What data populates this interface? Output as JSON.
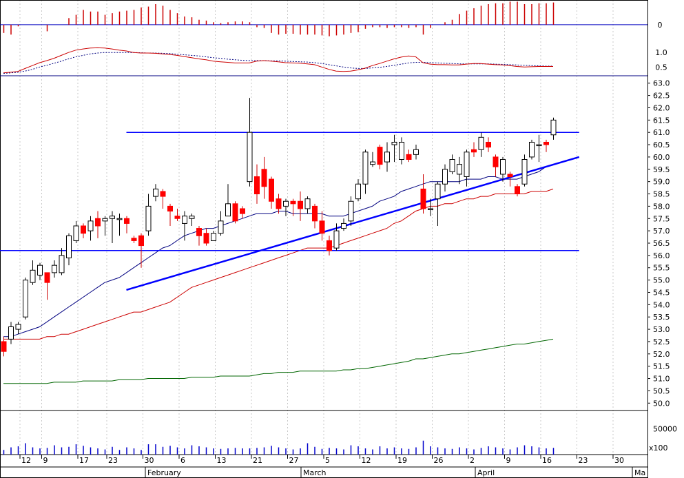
{
  "chart_data": {
    "type": "candlestick",
    "title": "",
    "xlabel": "",
    "ylabel": "",
    "x_axis": {
      "day_ticks": [
        "12",
        "9",
        "17",
        "23",
        "30",
        "6",
        "13",
        "21",
        "27",
        "5",
        "12",
        "19",
        "26",
        "2",
        "9",
        "16",
        "23",
        "30"
      ],
      "month_labels": [
        "February",
        "March",
        "April",
        "Ma"
      ]
    },
    "price_axis": {
      "ylim": [
        49.7,
        63.3
      ],
      "tick_labels": [
        "63.0",
        "62.5",
        "62.0",
        "61.5",
        "61.0",
        "60.5",
        "60.0",
        "59.5",
        "59.0",
        "58.5",
        "58.0",
        "57.5",
        "57.0",
        "56.5",
        "56.0",
        "55.5",
        "55.0",
        "54.5",
        "54.0",
        "53.5",
        "53.0",
        "52.5",
        "52.0",
        "51.5",
        "51.0",
        "50.5",
        "50.0"
      ]
    },
    "candles": [
      [
        52.5,
        52.1,
        52.7,
        51.9
      ],
      [
        52.6,
        53.1,
        53.3,
        52.4
      ],
      [
        53.0,
        53.2,
        53.3,
        52.8
      ],
      [
        53.5,
        55.0,
        55.1,
        53.4
      ],
      [
        54.9,
        55.4,
        55.8,
        54.8
      ],
      [
        55.2,
        55.6,
        55.7,
        55.0
      ],
      [
        55.3,
        54.9,
        55.3,
        54.2
      ],
      [
        55.3,
        55.6,
        55.8,
        55.1
      ],
      [
        55.3,
        56.0,
        56.3,
        55.2
      ],
      [
        55.9,
        56.8,
        56.9,
        55.6
      ],
      [
        56.6,
        57.2,
        57.4,
        56.5
      ],
      [
        57.2,
        56.9,
        57.3,
        56.7
      ],
      [
        57.0,
        57.4,
        57.6,
        56.6
      ],
      [
        57.5,
        57.2,
        57.8,
        56.7
      ],
      [
        57.4,
        57.5,
        57.6,
        56.8
      ],
      [
        57.5,
        57.6,
        57.8,
        56.5
      ],
      [
        57.5,
        57.5,
        57.7,
        56.8
      ],
      [
        57.5,
        57.3,
        57.6,
        56.9
      ],
      [
        56.7,
        56.6,
        56.8,
        56.5
      ],
      [
        56.8,
        56.4,
        56.9,
        55.5
      ],
      [
        57.0,
        58.0,
        58.5,
        56.8
      ],
      [
        58.4,
        58.7,
        58.9,
        58.2
      ],
      [
        58.6,
        58.4,
        58.7,
        57.9
      ],
      [
        58.0,
        57.8,
        58.1,
        57.2
      ],
      [
        57.6,
        57.5,
        57.9,
        57.4
      ],
      [
        57.3,
        57.6,
        57.8,
        56.6
      ],
      [
        57.5,
        57.6,
        57.7,
        57.2
      ],
      [
        57.1,
        56.8,
        57.2,
        56.4
      ],
      [
        56.9,
        56.5,
        57.1,
        56.4
      ],
      [
        56.6,
        56.9,
        57.0,
        56.6
      ],
      [
        56.9,
        57.4,
        57.8,
        56.8
      ],
      [
        57.6,
        58.1,
        58.9,
        57.6
      ],
      [
        58.1,
        57.4,
        58.2,
        57.3
      ],
      [
        57.9,
        57.7,
        58.0,
        57.5
      ],
      [
        59.0,
        61.0,
        62.4,
        58.8
      ],
      [
        59.2,
        58.5,
        59.7,
        58.1
      ],
      [
        59.5,
        58.8,
        60.0,
        58.3
      ],
      [
        59.1,
        58.2,
        59.2,
        57.9
      ],
      [
        58.3,
        57.9,
        58.5,
        57.7
      ],
      [
        58.0,
        58.2,
        58.3,
        57.6
      ],
      [
        58.2,
        58.1,
        58.3,
        57.6
      ],
      [
        58.2,
        57.9,
        58.6,
        57.4
      ],
      [
        57.9,
        58.3,
        58.4,
        57.7
      ],
      [
        58.0,
        57.4,
        58.1,
        57.1
      ],
      [
        57.4,
        56.9,
        57.8,
        56.6
      ],
      [
        56.6,
        56.2,
        56.8,
        56.0
      ],
      [
        56.3,
        57.0,
        57.3,
        56.2
      ],
      [
        57.1,
        57.3,
        57.5,
        57.0
      ],
      [
        57.4,
        58.2,
        58.4,
        57.2
      ],
      [
        58.3,
        58.9,
        59.1,
        58.2
      ],
      [
        58.9,
        60.2,
        60.3,
        58.5
      ],
      [
        59.7,
        59.8,
        60.2,
        59.6
      ],
      [
        60.4,
        59.7,
        60.5,
        59.5
      ],
      [
        59.8,
        60.2,
        60.6,
        59.4
      ],
      [
        60.5,
        60.6,
        60.9,
        59.8
      ],
      [
        59.9,
        60.6,
        60.8,
        59.7
      ],
      [
        60.1,
        59.9,
        60.3,
        59.8
      ],
      [
        60.1,
        60.3,
        60.5,
        59.9
      ],
      [
        58.7,
        57.9,
        59.3,
        57.7
      ],
      [
        57.9,
        57.9,
        58.3,
        57.6
      ],
      [
        58.3,
        58.9,
        59.0,
        57.2
      ],
      [
        58.9,
        59.5,
        59.7,
        58.6
      ],
      [
        59.4,
        59.9,
        60.1,
        59.3
      ],
      [
        59.3,
        59.7,
        60.0,
        58.9
      ],
      [
        59.2,
        60.2,
        60.3,
        58.8
      ],
      [
        60.3,
        60.2,
        60.6,
        60.0
      ],
      [
        60.3,
        60.8,
        61.0,
        60.0
      ],
      [
        60.6,
        60.4,
        60.8,
        60.2
      ],
      [
        60.0,
        59.6,
        60.1,
        59.2
      ],
      [
        59.3,
        59.9,
        60.0,
        59.0
      ],
      [
        59.3,
        59.2,
        59.4,
        58.8
      ],
      [
        58.8,
        58.5,
        58.9,
        58.4
      ],
      [
        58.9,
        59.9,
        60.1,
        58.8
      ],
      [
        60.0,
        60.6,
        60.7,
        59.9
      ],
      [
        60.5,
        60.5,
        60.9,
        59.8
      ],
      [
        60.6,
        60.5,
        60.7,
        60.2
      ],
      [
        60.9,
        61.5,
        61.6,
        60.7
      ]
    ],
    "overlays": {
      "ma_blue": [
        52.7,
        52.7,
        52.8,
        52.9,
        53.0,
        53.1,
        53.3,
        53.5,
        53.7,
        53.9,
        54.1,
        54.3,
        54.5,
        54.7,
        54.9,
        55.0,
        55.1,
        55.3,
        55.5,
        55.7,
        55.9,
        56.1,
        56.3,
        56.4,
        56.6,
        56.8,
        56.9,
        57.0,
        57.1,
        57.1,
        57.2,
        57.3,
        57.4,
        57.5,
        57.6,
        57.7,
        57.7,
        57.7,
        57.8,
        57.8,
        57.7,
        57.7,
        57.7,
        57.7,
        57.7,
        57.6,
        57.6,
        57.6,
        57.7,
        57.8,
        57.9,
        58.0,
        58.2,
        58.3,
        58.4,
        58.6,
        58.7,
        58.8,
        58.9,
        59.0,
        59.0,
        59.0,
        59.0,
        59.0,
        59.1,
        59.1,
        59.1,
        59.2,
        59.2,
        59.1,
        59.1,
        59.1,
        59.2,
        59.3,
        59.4,
        59.6,
        59.7
      ],
      "ma_red": [
        52.6,
        52.6,
        52.6,
        52.6,
        52.6,
        52.6,
        52.7,
        52.7,
        52.8,
        52.8,
        52.9,
        53.0,
        53.1,
        53.2,
        53.3,
        53.4,
        53.5,
        53.6,
        53.7,
        53.7,
        53.8,
        53.9,
        54.0,
        54.1,
        54.3,
        54.5,
        54.7,
        54.8,
        54.9,
        55.0,
        55.1,
        55.2,
        55.3,
        55.4,
        55.5,
        55.6,
        55.7,
        55.8,
        55.9,
        56.0,
        56.1,
        56.2,
        56.3,
        56.3,
        56.3,
        56.3,
        56.4,
        56.5,
        56.6,
        56.7,
        56.8,
        56.9,
        57.0,
        57.1,
        57.3,
        57.4,
        57.6,
        57.8,
        57.9,
        58.0,
        58.0,
        58.1,
        58.1,
        58.2,
        58.3,
        58.3,
        58.4,
        58.4,
        58.5,
        58.5,
        58.5,
        58.5,
        58.5,
        58.6,
        58.6,
        58.6,
        58.7
      ],
      "ma_green": [
        50.8,
        50.8,
        50.8,
        50.8,
        50.8,
        50.8,
        50.8,
        50.85,
        50.85,
        50.85,
        50.85,
        50.9,
        50.9,
        50.9,
        50.9,
        50.9,
        50.95,
        50.95,
        50.95,
        50.95,
        51.0,
        51.0,
        51.0,
        51.0,
        51.0,
        51.0,
        51.05,
        51.05,
        51.05,
        51.05,
        51.1,
        51.1,
        51.1,
        51.1,
        51.1,
        51.15,
        51.2,
        51.2,
        51.25,
        51.25,
        51.25,
        51.3,
        51.3,
        51.3,
        51.3,
        51.3,
        51.3,
        51.35,
        51.35,
        51.4,
        51.4,
        51.45,
        51.5,
        51.55,
        51.6,
        51.65,
        51.7,
        51.8,
        51.8,
        51.85,
        51.9,
        51.95,
        52.0,
        52.0,
        52.05,
        52.1,
        52.15,
        52.2,
        52.25,
        52.3,
        52.35,
        52.4,
        52.4,
        52.45,
        52.5,
        52.55,
        52.6
      ]
    },
    "trendlines": [
      {
        "color": "#0000ff",
        "from": [
          17,
          61.0
        ],
        "to": [
          79.6,
          61.0
        ]
      },
      {
        "color": "#0000ff",
        "from": [
          -1,
          56.2
        ],
        "to": [
          79.6,
          56.2
        ]
      },
      {
        "color": "#0000ff",
        "from": [
          17,
          54.6
        ],
        "to": [
          79.6,
          60.0
        ]
      }
    ],
    "macd_panel": {
      "tick_labels": [
        "1.0",
        "0.5"
      ],
      "ylim": [
        0.2,
        1.5
      ],
      "macd": [
        0.3,
        0.32,
        0.35,
        0.45,
        0.55,
        0.65,
        0.72,
        0.8,
        0.9,
        1.0,
        1.08,
        1.12,
        1.15,
        1.16,
        1.15,
        1.12,
        1.08,
        1.05,
        1.0,
        0.98,
        0.98,
        0.97,
        0.95,
        0.93,
        0.9,
        0.86,
        0.82,
        0.78,
        0.75,
        0.7,
        0.68,
        0.66,
        0.64,
        0.64,
        0.64,
        0.7,
        0.72,
        0.7,
        0.68,
        0.65,
        0.64,
        0.63,
        0.61,
        0.58,
        0.5,
        0.42,
        0.36,
        0.35,
        0.36,
        0.4,
        0.46,
        0.55,
        0.62,
        0.7,
        0.78,
        0.84,
        0.88,
        0.85,
        0.65,
        0.6,
        0.58,
        0.58,
        0.57,
        0.57,
        0.6,
        0.62,
        0.62,
        0.6,
        0.58,
        0.57,
        0.55,
        0.52,
        0.5,
        0.51,
        0.52,
        0.52,
        0.52
      ],
      "signal": [
        0.28,
        0.3,
        0.32,
        0.36,
        0.42,
        0.5,
        0.56,
        0.63,
        0.7,
        0.78,
        0.85,
        0.9,
        0.95,
        0.98,
        1.0,
        1.0,
        1.0,
        1.0,
        1.0,
        0.99,
        0.98,
        0.98,
        0.97,
        0.96,
        0.94,
        0.92,
        0.9,
        0.88,
        0.85,
        0.82,
        0.8,
        0.77,
        0.75,
        0.73,
        0.72,
        0.72,
        0.72,
        0.71,
        0.71,
        0.7,
        0.69,
        0.68,
        0.67,
        0.65,
        0.62,
        0.58,
        0.54,
        0.5,
        0.47,
        0.45,
        0.45,
        0.47,
        0.49,
        0.52,
        0.56,
        0.6,
        0.64,
        0.66,
        0.66,
        0.65,
        0.64,
        0.63,
        0.62,
        0.61,
        0.61,
        0.61,
        0.61,
        0.61,
        0.6,
        0.59,
        0.58,
        0.57,
        0.56,
        0.55,
        0.54,
        0.53,
        0.53
      ]
    },
    "histogram_panel": {
      "tick_labels": [
        "0"
      ],
      "ylim": [
        -1.6,
        3.0
      ],
      "values": [
        -1.0,
        -1.2,
        -0.2,
        0,
        0,
        0,
        -0.8,
        0,
        0,
        0.8,
        1.2,
        1.8,
        1.6,
        1.6,
        1.2,
        1.4,
        1.6,
        1.7,
        1.8,
        2.1,
        2.2,
        2.5,
        2.3,
        1.8,
        1.4,
        1.0,
        0.9,
        0.6,
        0.5,
        0.3,
        0.2,
        0.3,
        0.4,
        0.4,
        0.3,
        -0.3,
        -0.4,
        -1.0,
        -1.2,
        -1.1,
        -1.1,
        -1.2,
        -1.2,
        -1.2,
        -1.3,
        -1.4,
        -1.3,
        -1.2,
        -1.0,
        -0.9,
        -0.5,
        -0.3,
        -0.3,
        -0.4,
        -0.3,
        -0.3,
        -0.4,
        -0.3,
        -1.2,
        -0.4,
        0.0,
        0.3,
        0.6,
        1.3,
        1.7,
        2.0,
        2.3,
        2.5,
        2.6,
        2.6,
        2.8,
        2.8,
        2.5,
        2.5,
        2.6,
        2.6,
        2.7
      ]
    },
    "volume_panel": {
      "tick_labels": [
        "50000"
      ],
      "unit_label": "x100",
      "ylim": [
        0,
        80000
      ],
      "values": [
        9000,
        14000,
        16000,
        22000,
        14000,
        12000,
        13000,
        18000,
        14000,
        15000,
        20000,
        17000,
        14000,
        12000,
        10000,
        15000,
        9000,
        14000,
        12000,
        9000,
        20000,
        20000,
        15000,
        17000,
        14000,
        12000,
        18000,
        16000,
        14000,
        12000,
        11000,
        12000,
        13000,
        12000,
        12000,
        13000,
        14000,
        17000,
        14000,
        12000,
        10000,
        12000,
        22000,
        15000,
        11000,
        13000,
        12000,
        10000,
        18000,
        16000,
        12000,
        10000,
        16000,
        12000,
        14000,
        12000,
        11000,
        14000,
        27000,
        16000,
        14000,
        12000,
        11000,
        14000,
        12000,
        10000,
        13000,
        16000,
        14000,
        12000,
        10000,
        14000,
        18000,
        16000,
        14000,
        12000,
        13000
      ]
    }
  }
}
